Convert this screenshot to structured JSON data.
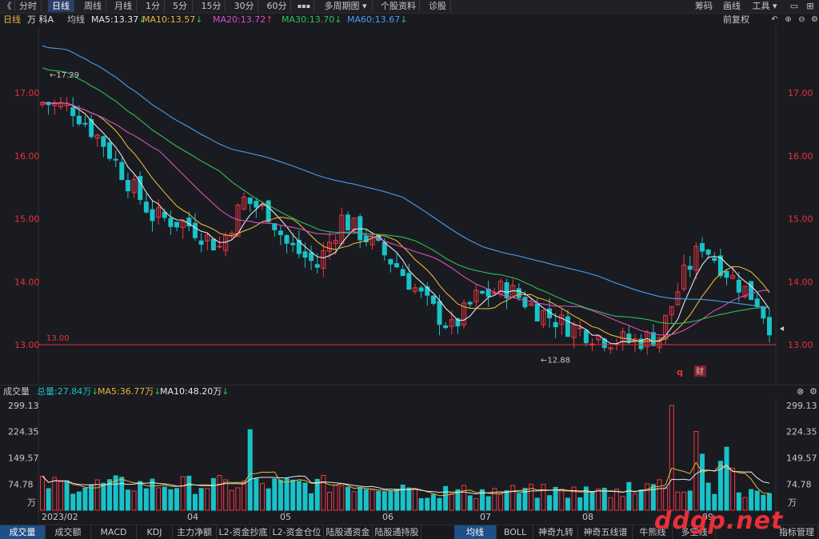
{
  "toolbar": {
    "back_label": "《",
    "buttons": [
      "分时",
      "日线",
      "周线",
      "月线",
      "1分",
      "5分",
      "15分",
      "30分",
      "60分",
      "▪▪▪",
      "多周期图 ▾",
      "个股资料",
      "诊股"
    ],
    "active_index": 1,
    "right_buttons": [
      "筹码",
      "画线",
      "工具 ▾"
    ]
  },
  "chart_header": {
    "period": "日线",
    "stock_name": "万 科A",
    "avg_line_label": "均线",
    "ma": [
      {
        "label": "MA5:13.37",
        "arrow": "↓",
        "color": "#e6e6e6"
      },
      {
        "label": "MA10:13.57",
        "arrow": "↓",
        "color": "#e8b53a"
      },
      {
        "label": "MA20:13.72",
        "arrow": "↑",
        "color": "#d94fc2"
      },
      {
        "label": "MA30:13.70",
        "arrow": "↓",
        "color": "#2fbf56"
      },
      {
        "label": "MA60:13.67",
        "arrow": "↓",
        "color": "#4a9df0"
      }
    ],
    "adjust_label": "前复权"
  },
  "volume_header": {
    "title": "成交量",
    "total": "总量:27.84万",
    "total_arrow": "↓",
    "ma5": "MA5:36.77万",
    "ma5_arrow": "↓",
    "ma10": "MA10:48.20万",
    "ma10_arrow": "↓"
  },
  "bottom_tabs": {
    "left": [
      "成交量",
      "成交额",
      "MACD",
      "KDJ",
      "主力净额",
      "L2-资金抄底",
      "L2-资金仓位",
      "陆股通资金",
      "陆股通持股"
    ],
    "left_active": 0,
    "right": [
      "均线",
      "BOLL",
      "神奇九转",
      "神奇五线谱",
      "牛熊线",
      "多空线",
      "指标管理"
    ],
    "right_active": 0
  },
  "annotations": {
    "high": "17.29",
    "low": "12.88",
    "support": "13.00",
    "badge_q": "q",
    "badge_cai": "财"
  },
  "watermark": "ddgp.net",
  "colors": {
    "up": "#f23645",
    "down": "#19c2c8",
    "ma5": "#e6e6e6",
    "ma10": "#e8b53a",
    "ma20": "#d94fc2",
    "ma30": "#2fbf56",
    "ma60": "#4a9df0",
    "axis_text": "#e8303a",
    "bg": "#1a1b20"
  },
  "chart_data": [
    {
      "type": "candlestick",
      "title": "万 科A 日线",
      "y_ticks": [
        17.0,
        16.0,
        15.0,
        14.0,
        13.0
      ],
      "ylim": [
        12.5,
        17.9
      ],
      "x_ticks": [
        "2023/02",
        "04",
        "05",
        "06",
        "07",
        "08",
        "09"
      ],
      "series": [
        {
          "name": "MA5",
          "values": [
            16.85,
            16.8,
            16.7,
            16.5,
            16.3,
            16.05,
            15.8,
            15.55,
            15.35,
            15.2,
            15.12,
            15.1,
            15.05,
            14.95,
            14.85,
            14.72,
            14.62,
            14.7,
            14.85,
            15.05,
            15.1,
            15.0,
            14.85,
            14.6,
            14.4,
            14.3,
            14.35,
            14.55,
            14.7,
            14.6,
            14.4,
            14.2,
            13.95,
            13.75,
            13.5,
            13.35,
            13.45,
            13.6,
            13.75,
            13.9,
            13.95,
            13.8,
            13.6,
            13.45,
            13.4,
            13.32,
            13.25,
            13.2,
            13.1,
            13.05,
            13.15,
            13.35,
            13.75,
            14.1,
            14.3,
            14.2,
            14.0,
            13.9,
            13.85,
            13.7,
            13.55,
            13.2,
            13.3,
            13.75,
            14.0,
            13.95,
            13.8,
            13.6,
            13.4,
            13.37
          ]
        },
        {
          "name": "MA10",
          "values": [
            16.8,
            16.75,
            16.68,
            16.58,
            16.45,
            16.28,
            16.05,
            15.85,
            15.65,
            15.48,
            15.35,
            15.25,
            15.15,
            15.05,
            14.95,
            14.85,
            14.78,
            14.75,
            14.8,
            14.9,
            14.95,
            14.98,
            14.92,
            14.8,
            14.65,
            14.5,
            14.4,
            14.38,
            14.45,
            14.48,
            14.45,
            14.35,
            14.15,
            13.95,
            13.75,
            13.58,
            13.5,
            13.5,
            13.58,
            13.7,
            13.78,
            13.8,
            13.72,
            13.6,
            13.5,
            13.4,
            13.33,
            13.27,
            13.2,
            13.15,
            13.15,
            13.2,
            13.4,
            13.65,
            13.9,
            14.05,
            14.08,
            14.02,
            13.95,
            13.85,
            13.72,
            13.5,
            13.38,
            13.45,
            13.62,
            13.8,
            13.85,
            13.78,
            13.65,
            13.57
          ]
        }
      ]
    },
    {
      "type": "bar",
      "title": "成交量",
      "unit": "万",
      "y_ticks": [
        299.13,
        224.35,
        149.57,
        74.78
      ],
      "ylim": [
        0,
        310
      ],
      "x_ticks": [
        "2023/02",
        "04",
        "05",
        "06",
        "07",
        "08",
        "09"
      ]
    }
  ]
}
